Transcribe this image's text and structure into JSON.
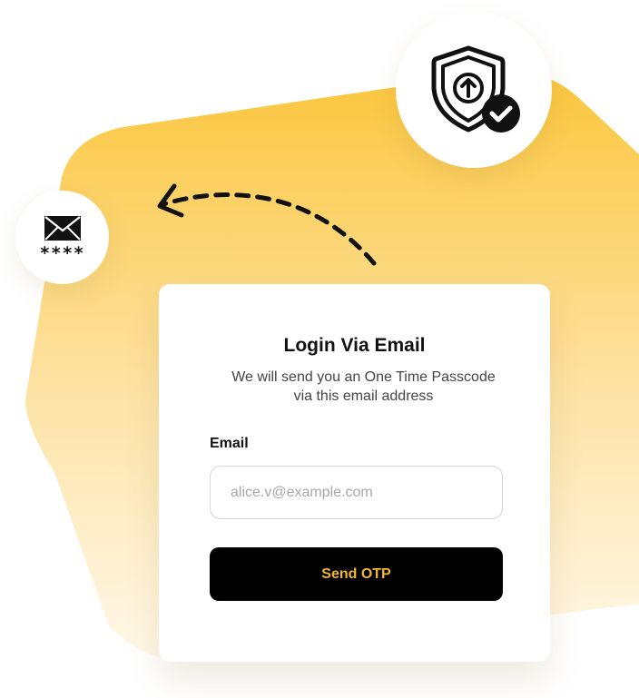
{
  "colors": {
    "accent": "#f2b82a",
    "background_shape_top": "#fbc63d",
    "background_shape_bottom": "#fff6e0",
    "button_bg": "#000000"
  },
  "icons": {
    "shield": "shield-upload-check-icon",
    "mail": "envelope-icon",
    "arrow": "dashed-curved-arrow-icon"
  },
  "mail_badge": {
    "masked_code": "****"
  },
  "card": {
    "title": "Login Via Email",
    "subtitle": "We will send you an One Time Passcode via this email address",
    "email_label": "Email",
    "email_placeholder": "alice.v@example.com",
    "email_value": "",
    "submit_label": "Send OTP"
  }
}
